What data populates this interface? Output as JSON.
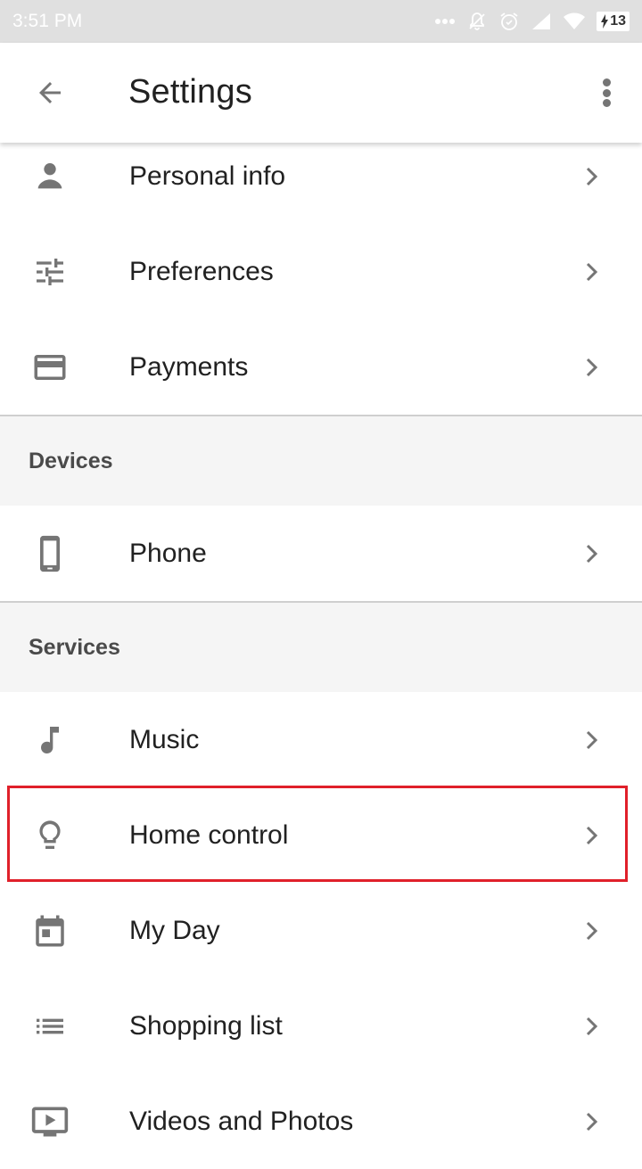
{
  "status_bar": {
    "time": "3:51 PM",
    "battery": "13",
    "icons": [
      "more-dots-icon",
      "silent-bell-icon",
      "alarm-icon",
      "signal-icon",
      "wifi-icon",
      "battery-charging-icon"
    ]
  },
  "app_bar": {
    "back_icon": "arrow-back-icon",
    "title": "Settings",
    "menu_icon": "more-vert-icon"
  },
  "sections": [
    {
      "header": null,
      "items": [
        {
          "label": "Personal info",
          "icon": "person-icon"
        },
        {
          "label": "Preferences",
          "icon": "tune-icon"
        },
        {
          "label": "Payments",
          "icon": "credit-card-icon"
        }
      ]
    },
    {
      "header": "Devices",
      "items": [
        {
          "label": "Phone",
          "icon": "smartphone-icon"
        }
      ]
    },
    {
      "header": "Services",
      "items": [
        {
          "label": "Music",
          "icon": "music-note-icon"
        },
        {
          "label": "Home control",
          "icon": "lightbulb-icon",
          "highlighted": true
        },
        {
          "label": "My Day",
          "icon": "calendar-icon"
        },
        {
          "label": "Shopping list",
          "icon": "list-icon"
        },
        {
          "label": "Videos and Photos",
          "icon": "tv-play-icon"
        }
      ]
    }
  ],
  "colors": {
    "status_bar_bg": "#e0e0e0",
    "icon_gray": "#757575",
    "section_bg": "#f5f5f5",
    "highlight_border": "#e0202a"
  }
}
